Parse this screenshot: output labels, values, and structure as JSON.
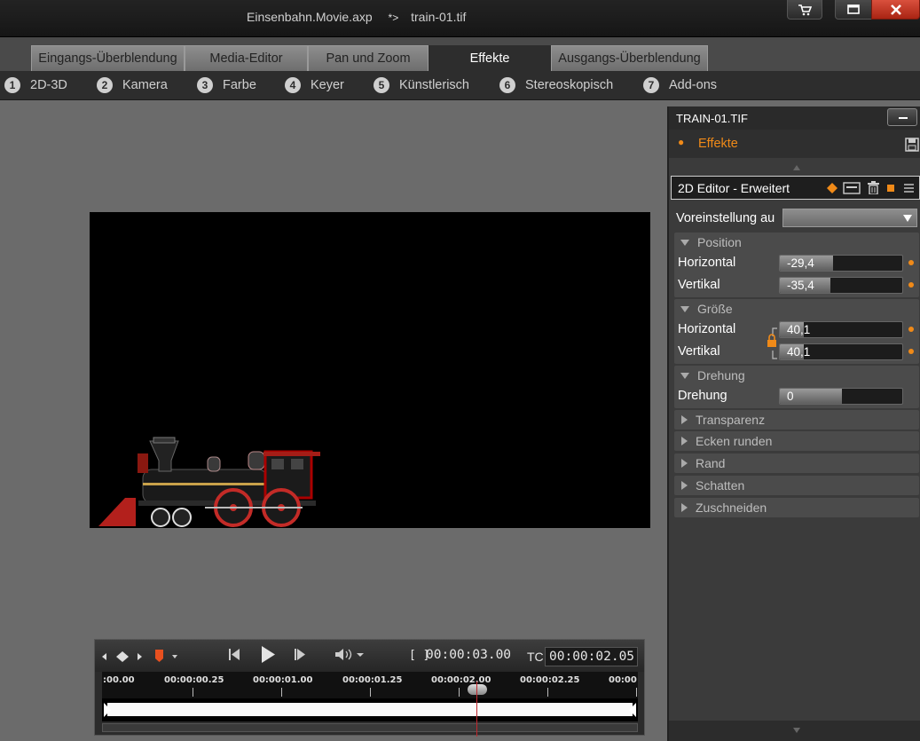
{
  "title": {
    "project": "Einsenbahn.Movie.axp",
    "separator": "*>",
    "clip": "train-01.tif"
  },
  "tabs": [
    {
      "label": "Eingangs-Überblendung",
      "active": false
    },
    {
      "label": "Media-Editor",
      "active": false
    },
    {
      "label": "Pan und Zoom",
      "active": false
    },
    {
      "label": "Effekte",
      "active": true
    },
    {
      "label": "Ausgangs-Überblendung",
      "active": false
    }
  ],
  "categories": [
    {
      "num": "1",
      "label": "2D-3D"
    },
    {
      "num": "2",
      "label": "Kamera"
    },
    {
      "num": "3",
      "label": "Farbe"
    },
    {
      "num": "4",
      "label": "Keyer"
    },
    {
      "num": "5",
      "label": "Künstlerisch"
    },
    {
      "num": "6",
      "label": "Stereoskopisch"
    },
    {
      "num": "7",
      "label": "Add-ons"
    }
  ],
  "transport": {
    "duration_label": "[ ]",
    "duration": "00:00:03.00",
    "tc_label": "TC",
    "timecode": "00:00:02.05",
    "ruler": [
      ":00.00",
      "00:00:00.25",
      "00:00:01.00",
      "00:00:01.25",
      "00:00:02.00",
      "00:00:02.25",
      "00:00"
    ]
  },
  "panel": {
    "title": "TRAIN-01.TIF",
    "effects_label": "Effekte",
    "editor_title": "2D Editor - Erweitert",
    "preset_label": "Voreinstellung au",
    "preset_value": "",
    "sections": {
      "position": {
        "title": "Position",
        "horizontal_label": "Horizontal",
        "horizontal_value": "-29,4",
        "vertical_label": "Vertikal",
        "vertical_value": "-35,4"
      },
      "size": {
        "title": "Größe",
        "horizontal_label": "Horizontal",
        "horizontal_value": "40,1",
        "vertical_label": "Vertikal",
        "vertical_value": "40,1"
      },
      "rotation": {
        "title": "Drehung",
        "rotation_label": "Drehung",
        "rotation_value": "0"
      },
      "collapsed": [
        "Transparenz",
        "Ecken runden",
        "Rand",
        "Schatten",
        "Zuschneiden"
      ]
    }
  },
  "colors": {
    "accent": "#f08a18",
    "playhead": "#c0272d",
    "close_button": "#c93b28"
  }
}
